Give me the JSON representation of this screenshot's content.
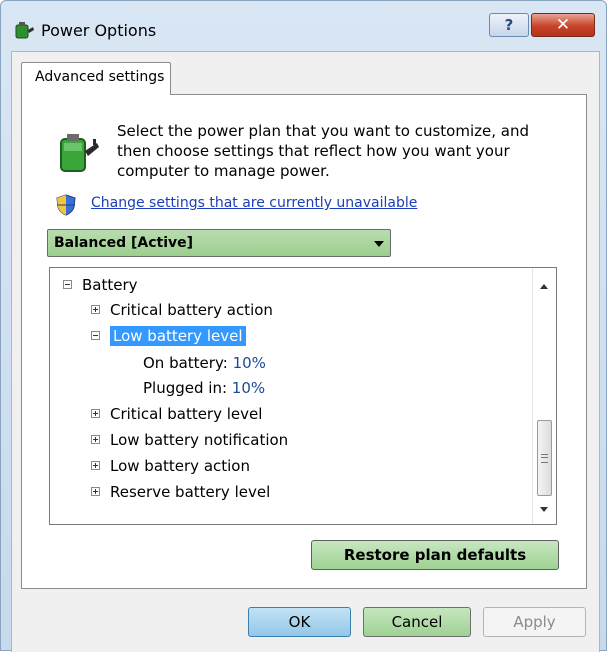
{
  "window": {
    "title": "Power Options",
    "help_label": "?",
    "close_label": "✕"
  },
  "tab": {
    "label": "Advanced settings"
  },
  "description": "Select the power plan that you want to customize, and then choose settings that reflect how you want your computer to manage power.",
  "change_link": "Change settings that are currently unavailable",
  "plan_select": {
    "value": "Balanced [Active]"
  },
  "tree": {
    "root": "Battery",
    "critical_action": "Critical battery action",
    "low_level": "Low battery level",
    "on_battery_label": "On battery:",
    "on_battery_value": "10%",
    "plugged_in_label": "Plugged in:",
    "plugged_in_value": "10%",
    "critical_level": "Critical battery level",
    "low_notification": "Low battery notification",
    "low_action": "Low battery action",
    "reserve_level": "Reserve battery level"
  },
  "buttons": {
    "restore": "Restore plan defaults",
    "ok": "OK",
    "cancel": "Cancel",
    "apply": "Apply"
  },
  "colors": {
    "selection": "#3399ff",
    "link": "#1a3fb8",
    "close": "#c7432a"
  },
  "icons": {
    "app": "power-options-icon",
    "battery": "battery-plug-icon",
    "shield": "uac-shield-icon"
  }
}
